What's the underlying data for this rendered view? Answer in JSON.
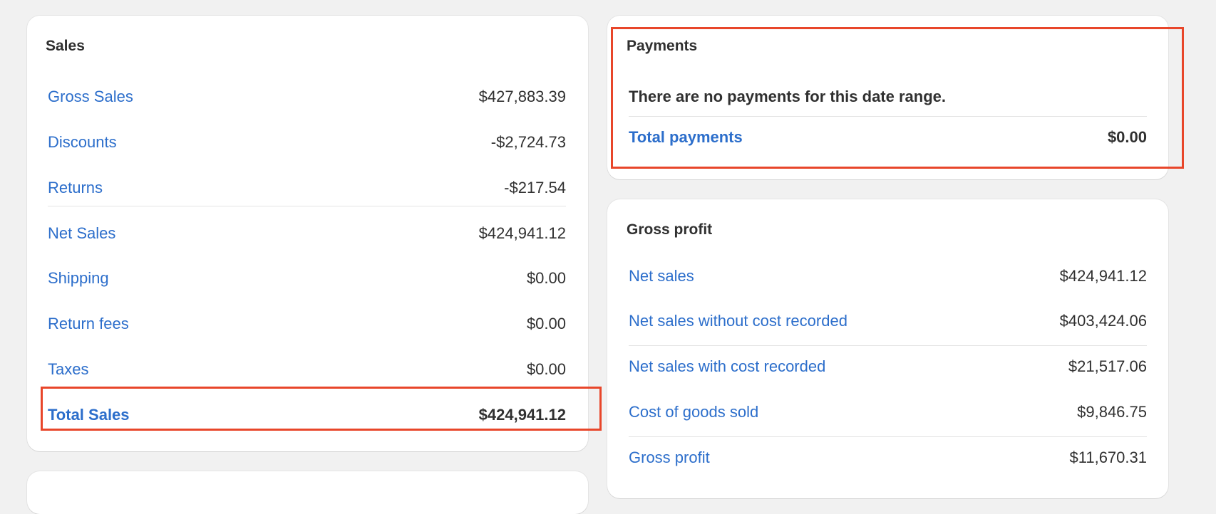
{
  "sales": {
    "title": "Sales",
    "rows": [
      {
        "label": "Gross Sales",
        "value": "$427,883.39"
      },
      {
        "label": "Discounts",
        "value": "-$2,724.73"
      },
      {
        "label": "Returns",
        "value": "-$217.54"
      },
      {
        "label": "Net Sales",
        "value": "$424,941.12"
      },
      {
        "label": "Shipping",
        "value": "$0.00"
      },
      {
        "label": "Return fees",
        "value": "$0.00"
      },
      {
        "label": "Taxes",
        "value": "$0.00"
      },
      {
        "label": "Total Sales",
        "value": "$424,941.12"
      }
    ]
  },
  "payments": {
    "title": "Payments",
    "message": "There are no payments for this date range.",
    "total_label": "Total payments",
    "total_value": "$0.00"
  },
  "gross_profit": {
    "title": "Gross profit",
    "rows": [
      {
        "label": "Net sales",
        "value": "$424,941.12"
      },
      {
        "label": "Net sales without cost recorded",
        "value": "$403,424.06"
      },
      {
        "label": "Net sales with cost recorded",
        "value": "$21,517.06"
      },
      {
        "label": "Cost of goods sold",
        "value": "$9,846.75"
      },
      {
        "label": "Gross profit",
        "value": "$11,670.31"
      }
    ]
  },
  "colors": {
    "link": "#2c6ecb",
    "highlight": "#e8462a",
    "background": "#f1f1f1"
  }
}
